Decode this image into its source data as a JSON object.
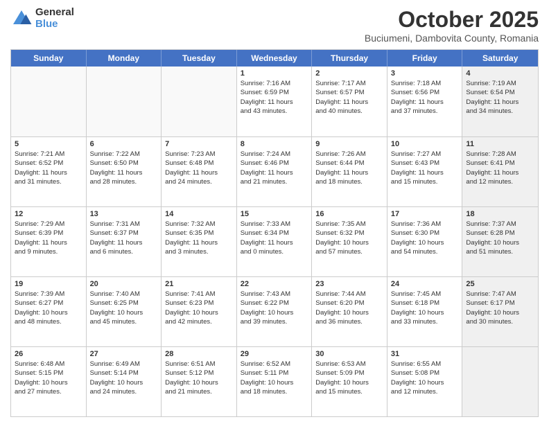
{
  "logo": {
    "general": "General",
    "blue": "Blue"
  },
  "title": "October 2025",
  "subtitle": "Buciumeni, Dambovita County, Romania",
  "days_of_week": [
    "Sunday",
    "Monday",
    "Tuesday",
    "Wednesday",
    "Thursday",
    "Friday",
    "Saturday"
  ],
  "weeks": [
    [
      {
        "day": "",
        "info": "",
        "empty": true
      },
      {
        "day": "",
        "info": "",
        "empty": true
      },
      {
        "day": "",
        "info": "",
        "empty": true
      },
      {
        "day": "1",
        "info": "Sunrise: 7:16 AM\nSunset: 6:59 PM\nDaylight: 11 hours\nand 43 minutes.",
        "empty": false
      },
      {
        "day": "2",
        "info": "Sunrise: 7:17 AM\nSunset: 6:57 PM\nDaylight: 11 hours\nand 40 minutes.",
        "empty": false
      },
      {
        "day": "3",
        "info": "Sunrise: 7:18 AM\nSunset: 6:56 PM\nDaylight: 11 hours\nand 37 minutes.",
        "empty": false
      },
      {
        "day": "4",
        "info": "Sunrise: 7:19 AM\nSunset: 6:54 PM\nDaylight: 11 hours\nand 34 minutes.",
        "empty": false,
        "shaded": true
      }
    ],
    [
      {
        "day": "5",
        "info": "Sunrise: 7:21 AM\nSunset: 6:52 PM\nDaylight: 11 hours\nand 31 minutes.",
        "empty": false
      },
      {
        "day": "6",
        "info": "Sunrise: 7:22 AM\nSunset: 6:50 PM\nDaylight: 11 hours\nand 28 minutes.",
        "empty": false
      },
      {
        "day": "7",
        "info": "Sunrise: 7:23 AM\nSunset: 6:48 PM\nDaylight: 11 hours\nand 24 minutes.",
        "empty": false
      },
      {
        "day": "8",
        "info": "Sunrise: 7:24 AM\nSunset: 6:46 PM\nDaylight: 11 hours\nand 21 minutes.",
        "empty": false
      },
      {
        "day": "9",
        "info": "Sunrise: 7:26 AM\nSunset: 6:44 PM\nDaylight: 11 hours\nand 18 minutes.",
        "empty": false
      },
      {
        "day": "10",
        "info": "Sunrise: 7:27 AM\nSunset: 6:43 PM\nDaylight: 11 hours\nand 15 minutes.",
        "empty": false
      },
      {
        "day": "11",
        "info": "Sunrise: 7:28 AM\nSunset: 6:41 PM\nDaylight: 11 hours\nand 12 minutes.",
        "empty": false,
        "shaded": true
      }
    ],
    [
      {
        "day": "12",
        "info": "Sunrise: 7:29 AM\nSunset: 6:39 PM\nDaylight: 11 hours\nand 9 minutes.",
        "empty": false
      },
      {
        "day": "13",
        "info": "Sunrise: 7:31 AM\nSunset: 6:37 PM\nDaylight: 11 hours\nand 6 minutes.",
        "empty": false
      },
      {
        "day": "14",
        "info": "Sunrise: 7:32 AM\nSunset: 6:35 PM\nDaylight: 11 hours\nand 3 minutes.",
        "empty": false
      },
      {
        "day": "15",
        "info": "Sunrise: 7:33 AM\nSunset: 6:34 PM\nDaylight: 11 hours\nand 0 minutes.",
        "empty": false
      },
      {
        "day": "16",
        "info": "Sunrise: 7:35 AM\nSunset: 6:32 PM\nDaylight: 10 hours\nand 57 minutes.",
        "empty": false
      },
      {
        "day": "17",
        "info": "Sunrise: 7:36 AM\nSunset: 6:30 PM\nDaylight: 10 hours\nand 54 minutes.",
        "empty": false
      },
      {
        "day": "18",
        "info": "Sunrise: 7:37 AM\nSunset: 6:28 PM\nDaylight: 10 hours\nand 51 minutes.",
        "empty": false,
        "shaded": true
      }
    ],
    [
      {
        "day": "19",
        "info": "Sunrise: 7:39 AM\nSunset: 6:27 PM\nDaylight: 10 hours\nand 48 minutes.",
        "empty": false
      },
      {
        "day": "20",
        "info": "Sunrise: 7:40 AM\nSunset: 6:25 PM\nDaylight: 10 hours\nand 45 minutes.",
        "empty": false
      },
      {
        "day": "21",
        "info": "Sunrise: 7:41 AM\nSunset: 6:23 PM\nDaylight: 10 hours\nand 42 minutes.",
        "empty": false
      },
      {
        "day": "22",
        "info": "Sunrise: 7:43 AM\nSunset: 6:22 PM\nDaylight: 10 hours\nand 39 minutes.",
        "empty": false
      },
      {
        "day": "23",
        "info": "Sunrise: 7:44 AM\nSunset: 6:20 PM\nDaylight: 10 hours\nand 36 minutes.",
        "empty": false
      },
      {
        "day": "24",
        "info": "Sunrise: 7:45 AM\nSunset: 6:18 PM\nDaylight: 10 hours\nand 33 minutes.",
        "empty": false
      },
      {
        "day": "25",
        "info": "Sunrise: 7:47 AM\nSunset: 6:17 PM\nDaylight: 10 hours\nand 30 minutes.",
        "empty": false,
        "shaded": true
      }
    ],
    [
      {
        "day": "26",
        "info": "Sunrise: 6:48 AM\nSunset: 5:15 PM\nDaylight: 10 hours\nand 27 minutes.",
        "empty": false
      },
      {
        "day": "27",
        "info": "Sunrise: 6:49 AM\nSunset: 5:14 PM\nDaylight: 10 hours\nand 24 minutes.",
        "empty": false
      },
      {
        "day": "28",
        "info": "Sunrise: 6:51 AM\nSunset: 5:12 PM\nDaylight: 10 hours\nand 21 minutes.",
        "empty": false
      },
      {
        "day": "29",
        "info": "Sunrise: 6:52 AM\nSunset: 5:11 PM\nDaylight: 10 hours\nand 18 minutes.",
        "empty": false
      },
      {
        "day": "30",
        "info": "Sunrise: 6:53 AM\nSunset: 5:09 PM\nDaylight: 10 hours\nand 15 minutes.",
        "empty": false
      },
      {
        "day": "31",
        "info": "Sunrise: 6:55 AM\nSunset: 5:08 PM\nDaylight: 10 hours\nand 12 minutes.",
        "empty": false
      },
      {
        "day": "",
        "info": "",
        "empty": true,
        "shaded": true
      }
    ]
  ]
}
